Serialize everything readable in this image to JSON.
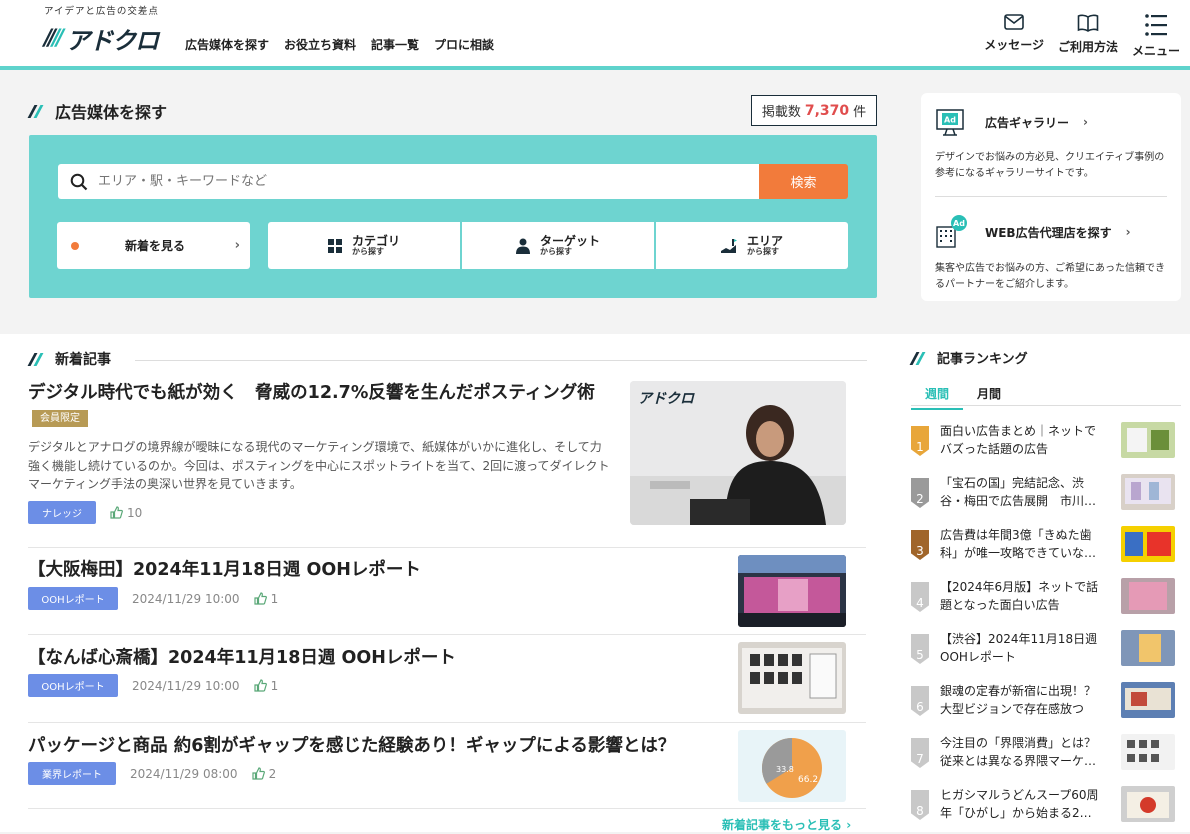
{
  "header": {
    "tagline": "アイデアと広告の交差点",
    "logo_text": "アドクロ",
    "nav": [
      "広告媒体を探す",
      "お役立ち資料",
      "記事一覧",
      "プロに相談"
    ],
    "icons": [
      {
        "label": "メッセージ",
        "icon": "envelope-icon"
      },
      {
        "label": "ご利用方法",
        "icon": "book-icon"
      },
      {
        "label": "メニュー",
        "icon": "menu-icon"
      }
    ]
  },
  "search": {
    "title": "広告媒体を探す",
    "count_prefix": "掲載数",
    "count_value": "7,370",
    "count_unit": "件",
    "placeholder": "エリア・駅・キーワードなど",
    "button": "検索",
    "new_label": "新着を見る",
    "browse": [
      {
        "label": "カテゴリ",
        "sub": "から探す",
        "icon": "grid-icon"
      },
      {
        "label": "ターゲット",
        "sub": "から探す",
        "icon": "person-icon"
      },
      {
        "label": "エリア",
        "sub": "から探す",
        "icon": "area-icon"
      }
    ]
  },
  "side": {
    "gallery_title": "広告ギャラリー",
    "gallery_desc": "デザインでお悩みの方必見、クリエイティブ事例の参考になるギャラリーサイトです。",
    "agency_title": "WEB広告代理店を探す",
    "agency_desc": "集客や広告でお悩みの方、ご希望にあった信頼できるパートナーをご紹介します。",
    "ad_badge": "Ad"
  },
  "news": {
    "title": "新着記事",
    "featured": {
      "title": "デジタル時代でも紙が効く　脅威の12.7%反響を生んだポスティング術",
      "badge": "会員限定",
      "desc": "デジタルとアナログの境界線が曖昧になる現代のマーケティング環境で、紙媒体がいかに進化し、そして力強く機能し続けているのか。今回は、ポスティングを中心にスポットライトを当て、2回に渡ってダイレクトマーケティング手法の奥深い世界を見ていきます。",
      "tag": "ナレッジ",
      "likes": "10",
      "image_logo": "アドクロ"
    },
    "articles": [
      {
        "title": "【大阪梅田】2024年11月18日週 OOHレポート",
        "tag": "OOHレポート",
        "date": "2024/11/29 10:00",
        "likes": "1"
      },
      {
        "title": "【なんば心斎橋】2024年11月18日週 OOHレポート",
        "tag": "OOHレポート",
        "date": "2024/11/29 10:00",
        "likes": "1"
      },
      {
        "title": "パッケージと商品 約6割がギャップを感じた経験あり！ギャップによる影響とは？",
        "tag": "業界レポート",
        "date": "2024/11/29 08:00",
        "likes": "2"
      }
    ],
    "pie_labels": [
      "33.8",
      "66.2"
    ],
    "more": "新着記事をもっと見る"
  },
  "ranking": {
    "title": "記事ランキング",
    "tabs": [
      "週間",
      "月間"
    ],
    "items": [
      {
        "rank": "1",
        "title": "面白い広告まとめ｜ネットでバズった話題の広告",
        "color": "#e8a63a"
      },
      {
        "rank": "2",
        "title": "「宝石の国」完結記念、渋谷・梅田で広告展開　市川…",
        "color": "#9a9a9a"
      },
      {
        "rank": "3",
        "title": "広告費は年間3億「きぬた歯科」が唯一攻略できていな…",
        "color": "#a0652a"
      },
      {
        "rank": "4",
        "title": "【2024年6月版】ネットで話題となった面白い広告",
        "color": "#c8c8c8"
      },
      {
        "rank": "5",
        "title": "【渋谷】2024年11月18日週 OOHレポート",
        "color": "#c8c8c8"
      },
      {
        "rank": "6",
        "title": "銀魂の定春が新宿に出現！？大型ビジョンで存在感放つ",
        "color": "#c8c8c8"
      },
      {
        "rank": "7",
        "title": "今注目の「界隈消費」とは？従来とは異なる界隈マーケ…",
        "color": "#c8c8c8"
      },
      {
        "rank": "8",
        "title": "ヒガシマルうどんスープ60周年「ひがし」から始まる2…",
        "color": "#c8c8c8"
      }
    ]
  }
}
